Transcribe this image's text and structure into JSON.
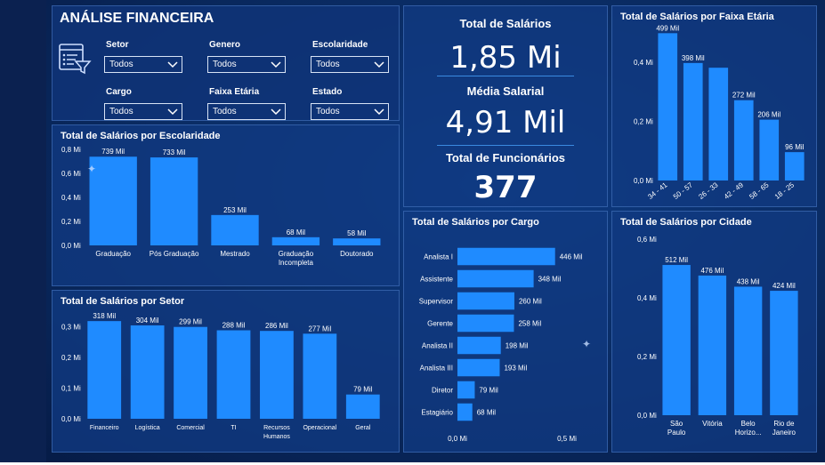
{
  "header": {
    "title": "ANÁLISE FINANCEIRA"
  },
  "filters": [
    {
      "label": "Setor",
      "value": "Todos"
    },
    {
      "label": "Genero",
      "value": "Todos"
    },
    {
      "label": "Escolaridade",
      "value": "Todos"
    },
    {
      "label": "Cargo",
      "value": "Todos"
    },
    {
      "label": "Faixa Etária",
      "value": "Todos"
    },
    {
      "label": "Estado",
      "value": "Todos"
    }
  ],
  "kpis": [
    {
      "label": "Total de Salários",
      "value": "1,85 Mi"
    },
    {
      "label": "Média Salarial",
      "value": "4,91 Mil"
    },
    {
      "label": "Total de Funcionários",
      "value": "377"
    }
  ],
  "colors": {
    "bar": "#1f8bff",
    "panel": "#113a82",
    "text": "#ffffff"
  },
  "chart_data": [
    {
      "type": "bar",
      "title": "Total de Salários por Escolaridade",
      "categories": [
        [
          "Graduação"
        ],
        [
          "Pós Graduação"
        ],
        [
          "Mestrado"
        ],
        [
          "Graduação",
          "Incompleta"
        ],
        [
          "Doutorado"
        ]
      ],
      "values": [
        739000,
        733000,
        253000,
        68000,
        58000
      ],
      "labels": [
        "739 Mil",
        "733 Mil",
        "253 Mil",
        "68 Mil",
        "58 Mil"
      ],
      "ylim": [
        0,
        800000
      ],
      "ticks": [
        0,
        200000,
        400000,
        600000,
        800000
      ],
      "tickLabels": [
        "0,0 Mi",
        "0,2 Mi",
        "0,4 Mi",
        "0,6 Mi",
        "0,8 Mi"
      ]
    },
    {
      "type": "bar",
      "title": "Total de Salários por Setor",
      "categories": [
        [
          "Financeiro"
        ],
        [
          "Logística"
        ],
        [
          "Comercial"
        ],
        [
          "TI"
        ],
        [
          "Recursos",
          "Humanos"
        ],
        [
          "Operacional"
        ],
        [
          "Geral"
        ]
      ],
      "values": [
        318000,
        304000,
        299000,
        288000,
        286000,
        277000,
        79000
      ],
      "labels": [
        "318 Mil",
        "304 Mil",
        "299 Mil",
        "288 Mil",
        "286 Mil",
        "277 Mil",
        "79 Mil"
      ],
      "ylim": [
        0,
        330000
      ],
      "ticks": [
        0,
        100000,
        200000,
        300000
      ],
      "tickLabels": [
        "0,0 Mi",
        "0,1 Mi",
        "0,2 Mi",
        "0,3 Mi"
      ]
    },
    {
      "type": "bar",
      "title": "Total de Salários por Faixa Etária",
      "categories": [
        [
          "34 - 41"
        ],
        [
          "50 - 57"
        ],
        [
          "26 - 33"
        ],
        [
          "42 - 49"
        ],
        [
          "58 - 65"
        ],
        [
          "18 - 25"
        ]
      ],
      "values": [
        499000,
        398000,
        382000,
        272000,
        206000,
        96000
      ],
      "labels": [
        "499 Mil",
        "398 Mil",
        "",
        "272 Mil",
        "206 Mil",
        "96 Mil"
      ],
      "ylim": [
        0,
        500000
      ],
      "ticks": [
        0,
        200000,
        400000
      ],
      "tickLabels": [
        "0,0 Mi",
        "0,2 Mi",
        "0,4 Mi"
      ]
    },
    {
      "type": "bar",
      "orientation": "horizontal",
      "title": "Total de Salários por Cargo",
      "categories": [
        "Analista I",
        "Assistente",
        "Supervisor",
        "Gerente",
        "Analista II",
        "Analista III",
        "Diretor",
        "Estagiário"
      ],
      "values": [
        446000,
        348000,
        260000,
        258000,
        198000,
        193000,
        79000,
        68000
      ],
      "labels": [
        "446 Mil",
        "348 Mil",
        "260 Mil",
        "258 Mil",
        "198 Mil",
        "193 Mil",
        "79 Mil",
        "68 Mil"
      ],
      "xlim": [
        0,
        500000
      ],
      "ticks": [
        0,
        500000
      ],
      "tickLabels": [
        "0,0 Mi",
        "0,5 Mi"
      ]
    },
    {
      "type": "bar",
      "title": "Total de Salários por Cidade",
      "categories": [
        [
          "São",
          "Paulo"
        ],
        [
          "Vitória"
        ],
        [
          "Belo",
          "Horizo..."
        ],
        [
          "Rio de",
          "Janeiro"
        ]
      ],
      "values": [
        512000,
        476000,
        438000,
        424000
      ],
      "labels": [
        "512 Mil",
        "476 Mil",
        "438 Mil",
        "424 Mil"
      ],
      "ylim": [
        0,
        600000
      ],
      "ticks": [
        0,
        200000,
        400000,
        600000
      ],
      "tickLabels": [
        "0,0 Mi",
        "0,2 Mi",
        "0,4 Mi",
        "0,6 Mi"
      ]
    }
  ]
}
